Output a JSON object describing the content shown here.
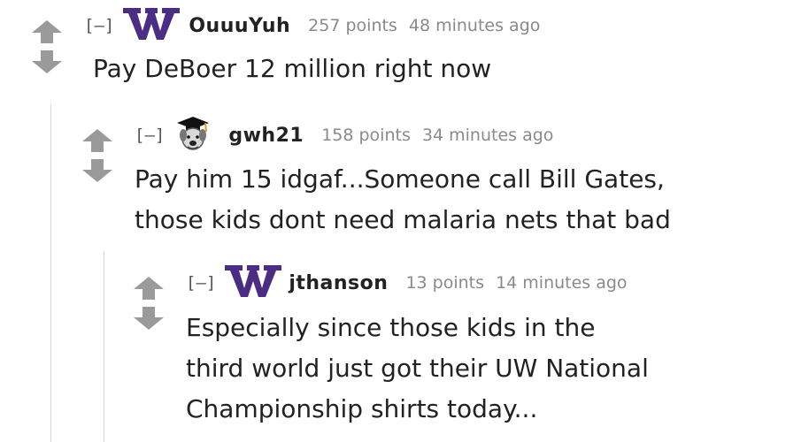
{
  "comments": [
    {
      "collapse": "[–]",
      "author": "OuuuYuh",
      "flair_icon": "uw-w-logo-icon",
      "points": "257 points",
      "time": "48 minutes ago",
      "lines": [
        "Pay DeBoer 12 million right now"
      ]
    },
    {
      "collapse": "[–]",
      "author": "gwh21",
      "flair_icon": "husky-mascot-icon",
      "points": "158 points",
      "time": "34 minutes ago",
      "lines": [
        "Pay him 15 idgaf...Someone call Bill Gates,",
        "those kids dont need malaria nets that bad"
      ]
    },
    {
      "collapse": "[–]",
      "author": "jthanson",
      "flair_icon": "uw-w-logo-icon",
      "points": "13 points",
      "time": "14 minutes ago",
      "lines": [
        "Especially since those kids in the",
        "third world just got their UW National",
        "Championship shirts today..."
      ]
    }
  ],
  "colors": {
    "arrow": "#9a9a9a",
    "uw_purple": "#4b2e83",
    "meta_text": "#8a8a8a",
    "thread_line": "#d8d8d8"
  }
}
